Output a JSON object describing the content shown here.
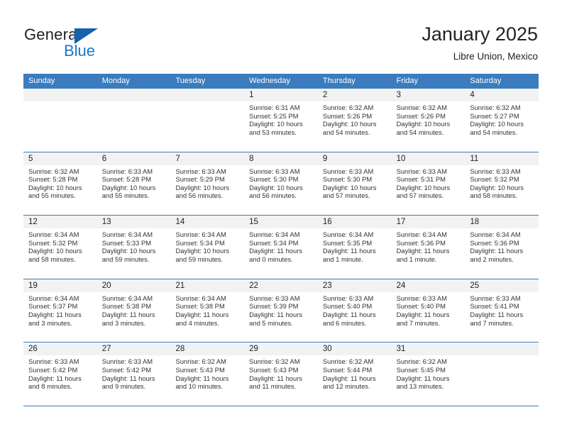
{
  "brand": {
    "name_part1": "General",
    "name_part2": "Blue",
    "accent_color": "#1878c8",
    "flag_color": "#1463ad"
  },
  "header": {
    "title": "January 2025",
    "subtitle": "Libre Union, Mexico"
  },
  "theme": {
    "header_row_color": "#3a7cbe",
    "day_band_color": "#f2f2f2"
  },
  "weekdays": [
    "Sunday",
    "Monday",
    "Tuesday",
    "Wednesday",
    "Thursday",
    "Friday",
    "Saturday"
  ],
  "weeks": [
    [
      {
        "empty": true
      },
      {
        "empty": true
      },
      {
        "empty": true
      },
      {
        "day": "1",
        "sunrise": "Sunrise: 6:31 AM",
        "sunset": "Sunset: 5:25 PM",
        "daylight_line1": "Daylight: 10 hours",
        "daylight_line2": "and 53 minutes."
      },
      {
        "day": "2",
        "sunrise": "Sunrise: 6:32 AM",
        "sunset": "Sunset: 5:26 PM",
        "daylight_line1": "Daylight: 10 hours",
        "daylight_line2": "and 54 minutes."
      },
      {
        "day": "3",
        "sunrise": "Sunrise: 6:32 AM",
        "sunset": "Sunset: 5:26 PM",
        "daylight_line1": "Daylight: 10 hours",
        "daylight_line2": "and 54 minutes."
      },
      {
        "day": "4",
        "sunrise": "Sunrise: 6:32 AM",
        "sunset": "Sunset: 5:27 PM",
        "daylight_line1": "Daylight: 10 hours",
        "daylight_line2": "and 54 minutes."
      }
    ],
    [
      {
        "day": "5",
        "sunrise": "Sunrise: 6:32 AM",
        "sunset": "Sunset: 5:28 PM",
        "daylight_line1": "Daylight: 10 hours",
        "daylight_line2": "and 55 minutes."
      },
      {
        "day": "6",
        "sunrise": "Sunrise: 6:33 AM",
        "sunset": "Sunset: 5:28 PM",
        "daylight_line1": "Daylight: 10 hours",
        "daylight_line2": "and 55 minutes."
      },
      {
        "day": "7",
        "sunrise": "Sunrise: 6:33 AM",
        "sunset": "Sunset: 5:29 PM",
        "daylight_line1": "Daylight: 10 hours",
        "daylight_line2": "and 56 minutes."
      },
      {
        "day": "8",
        "sunrise": "Sunrise: 6:33 AM",
        "sunset": "Sunset: 5:30 PM",
        "daylight_line1": "Daylight: 10 hours",
        "daylight_line2": "and 56 minutes."
      },
      {
        "day": "9",
        "sunrise": "Sunrise: 6:33 AM",
        "sunset": "Sunset: 5:30 PM",
        "daylight_line1": "Daylight: 10 hours",
        "daylight_line2": "and 57 minutes."
      },
      {
        "day": "10",
        "sunrise": "Sunrise: 6:33 AM",
        "sunset": "Sunset: 5:31 PM",
        "daylight_line1": "Daylight: 10 hours",
        "daylight_line2": "and 57 minutes."
      },
      {
        "day": "11",
        "sunrise": "Sunrise: 6:33 AM",
        "sunset": "Sunset: 5:32 PM",
        "daylight_line1": "Daylight: 10 hours",
        "daylight_line2": "and 58 minutes."
      }
    ],
    [
      {
        "day": "12",
        "sunrise": "Sunrise: 6:34 AM",
        "sunset": "Sunset: 5:32 PM",
        "daylight_line1": "Daylight: 10 hours",
        "daylight_line2": "and 58 minutes."
      },
      {
        "day": "13",
        "sunrise": "Sunrise: 6:34 AM",
        "sunset": "Sunset: 5:33 PM",
        "daylight_line1": "Daylight: 10 hours",
        "daylight_line2": "and 59 minutes."
      },
      {
        "day": "14",
        "sunrise": "Sunrise: 6:34 AM",
        "sunset": "Sunset: 5:34 PM",
        "daylight_line1": "Daylight: 10 hours",
        "daylight_line2": "and 59 minutes."
      },
      {
        "day": "15",
        "sunrise": "Sunrise: 6:34 AM",
        "sunset": "Sunset: 5:34 PM",
        "daylight_line1": "Daylight: 11 hours",
        "daylight_line2": "and 0 minutes."
      },
      {
        "day": "16",
        "sunrise": "Sunrise: 6:34 AM",
        "sunset": "Sunset: 5:35 PM",
        "daylight_line1": "Daylight: 11 hours",
        "daylight_line2": "and 1 minute."
      },
      {
        "day": "17",
        "sunrise": "Sunrise: 6:34 AM",
        "sunset": "Sunset: 5:36 PM",
        "daylight_line1": "Daylight: 11 hours",
        "daylight_line2": "and 1 minute."
      },
      {
        "day": "18",
        "sunrise": "Sunrise: 6:34 AM",
        "sunset": "Sunset: 5:36 PM",
        "daylight_line1": "Daylight: 11 hours",
        "daylight_line2": "and 2 minutes."
      }
    ],
    [
      {
        "day": "19",
        "sunrise": "Sunrise: 6:34 AM",
        "sunset": "Sunset: 5:37 PM",
        "daylight_line1": "Daylight: 11 hours",
        "daylight_line2": "and 3 minutes."
      },
      {
        "day": "20",
        "sunrise": "Sunrise: 6:34 AM",
        "sunset": "Sunset: 5:38 PM",
        "daylight_line1": "Daylight: 11 hours",
        "daylight_line2": "and 3 minutes."
      },
      {
        "day": "21",
        "sunrise": "Sunrise: 6:34 AM",
        "sunset": "Sunset: 5:38 PM",
        "daylight_line1": "Daylight: 11 hours",
        "daylight_line2": "and 4 minutes."
      },
      {
        "day": "22",
        "sunrise": "Sunrise: 6:33 AM",
        "sunset": "Sunset: 5:39 PM",
        "daylight_line1": "Daylight: 11 hours",
        "daylight_line2": "and 5 minutes."
      },
      {
        "day": "23",
        "sunrise": "Sunrise: 6:33 AM",
        "sunset": "Sunset: 5:40 PM",
        "daylight_line1": "Daylight: 11 hours",
        "daylight_line2": "and 6 minutes."
      },
      {
        "day": "24",
        "sunrise": "Sunrise: 6:33 AM",
        "sunset": "Sunset: 5:40 PM",
        "daylight_line1": "Daylight: 11 hours",
        "daylight_line2": "and 7 minutes."
      },
      {
        "day": "25",
        "sunrise": "Sunrise: 6:33 AM",
        "sunset": "Sunset: 5:41 PM",
        "daylight_line1": "Daylight: 11 hours",
        "daylight_line2": "and 7 minutes."
      }
    ],
    [
      {
        "day": "26",
        "sunrise": "Sunrise: 6:33 AM",
        "sunset": "Sunset: 5:42 PM",
        "daylight_line1": "Daylight: 11 hours",
        "daylight_line2": "and 8 minutes."
      },
      {
        "day": "27",
        "sunrise": "Sunrise: 6:33 AM",
        "sunset": "Sunset: 5:42 PM",
        "daylight_line1": "Daylight: 11 hours",
        "daylight_line2": "and 9 minutes."
      },
      {
        "day": "28",
        "sunrise": "Sunrise: 6:32 AM",
        "sunset": "Sunset: 5:43 PM",
        "daylight_line1": "Daylight: 11 hours",
        "daylight_line2": "and 10 minutes."
      },
      {
        "day": "29",
        "sunrise": "Sunrise: 6:32 AM",
        "sunset": "Sunset: 5:43 PM",
        "daylight_line1": "Daylight: 11 hours",
        "daylight_line2": "and 11 minutes."
      },
      {
        "day": "30",
        "sunrise": "Sunrise: 6:32 AM",
        "sunset": "Sunset: 5:44 PM",
        "daylight_line1": "Daylight: 11 hours",
        "daylight_line2": "and 12 minutes."
      },
      {
        "day": "31",
        "sunrise": "Sunrise: 6:32 AM",
        "sunset": "Sunset: 5:45 PM",
        "daylight_line1": "Daylight: 11 hours",
        "daylight_line2": "and 13 minutes."
      },
      {
        "empty": true
      }
    ]
  ]
}
